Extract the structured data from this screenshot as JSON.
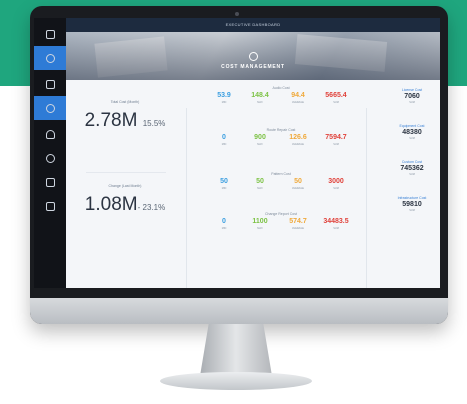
{
  "app": {
    "topbar_title": "EXECUTIVE DASHBOARD",
    "banner_title": "COST MANAGEMENT"
  },
  "sidebar": {
    "items": [
      {
        "icon": "home-icon",
        "label": "",
        "active": false
      },
      {
        "icon": "dashboard-icon",
        "label": "",
        "active": true
      },
      {
        "icon": "home-icon",
        "label": "",
        "active": false
      },
      {
        "icon": "cost-icon",
        "label": "",
        "active": true
      },
      {
        "icon": "heart-icon",
        "label": "",
        "active": false
      },
      {
        "icon": "search-analytics-icon",
        "label": "",
        "active": false
      },
      {
        "icon": "box-icon",
        "label": "",
        "active": false
      },
      {
        "icon": "grid-icon",
        "label": "",
        "active": false
      }
    ]
  },
  "kpis": [
    {
      "label": "Total Cost (Month)",
      "value": "2.78M",
      "change": "15.5%"
    },
    {
      "label": "Change (Last Month)",
      "value": "1.08M",
      "change": "- 23.1%"
    }
  ],
  "blocks": [
    {
      "title": "Audio Cost",
      "metrics": [
        {
          "value": "53.9",
          "label": "MIN",
          "color": "#3a9ee0"
        },
        {
          "value": "148.4",
          "label": "MAX",
          "color": "#7cc245"
        },
        {
          "value": "94.4",
          "label": "AVERAGE",
          "color": "#f0a93a"
        },
        {
          "value": "5665.4",
          "label": "SUM",
          "color": "#e0413a"
        }
      ]
    },
    {
      "title": "Route Repair Cost",
      "metrics": [
        {
          "value": "0",
          "label": "MIN",
          "color": "#3a9ee0"
        },
        {
          "value": "900",
          "label": "MAX",
          "color": "#7cc245"
        },
        {
          "value": "126.6",
          "label": "AVERAGE",
          "color": "#f0a93a"
        },
        {
          "value": "7594.7",
          "label": "SUM",
          "color": "#e0413a"
        }
      ]
    },
    {
      "title": "Pattern Cost",
      "metrics": [
        {
          "value": "50",
          "label": "MIN",
          "color": "#3a9ee0"
        },
        {
          "value": "50",
          "label": "MAX",
          "color": "#7cc245"
        },
        {
          "value": "50",
          "label": "AVERAGE",
          "color": "#f0a93a"
        },
        {
          "value": "3000",
          "label": "SUM",
          "color": "#e0413a"
        }
      ]
    },
    {
      "title": "Change Report Cost",
      "metrics": [
        {
          "value": "0",
          "label": "MIN",
          "color": "#3a9ee0"
        },
        {
          "value": "1100",
          "label": "MAX",
          "color": "#7cc245"
        },
        {
          "value": "574.7",
          "label": "AVERAGE",
          "color": "#f0a93a"
        },
        {
          "value": "34483.5",
          "label": "SUM",
          "color": "#e0413a"
        }
      ]
    }
  ],
  "right_items": [
    {
      "label": "License Cost",
      "value": "7060",
      "sub": "SUM"
    },
    {
      "label": "Equipment Cost",
      "value": "48380",
      "sub": "SUM"
    },
    {
      "label": "Custom Cost",
      "value": "745362",
      "sub": "SUM"
    },
    {
      "label": "Infrastructure Cost",
      "value": "59810",
      "sub": "SUM"
    }
  ]
}
